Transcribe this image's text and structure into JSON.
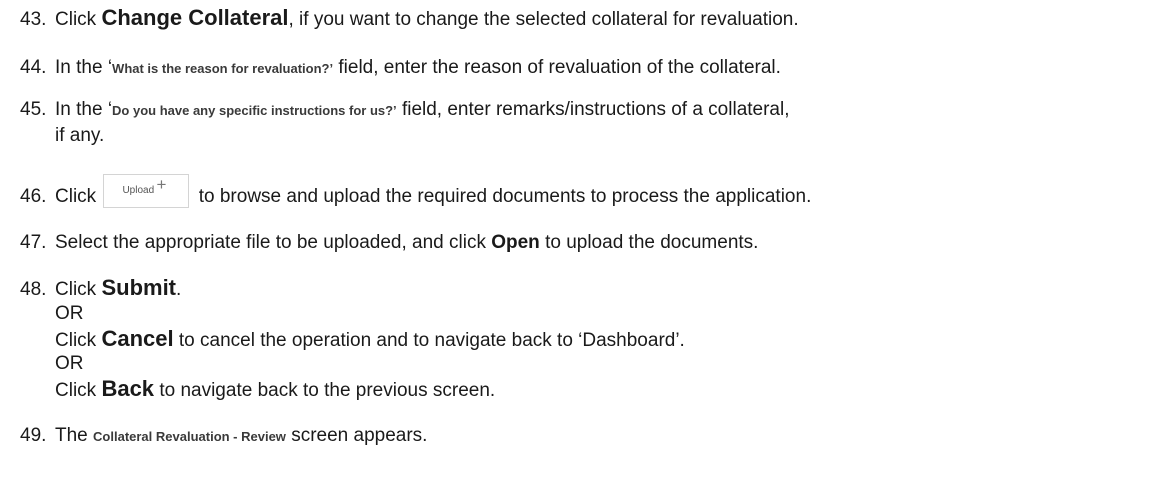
{
  "steps": {
    "s43": {
      "num": "43.",
      "pre": "Click ",
      "bold": "Change Collateral",
      "post": ", if you want to change the selected collateral for revaluation."
    },
    "s44": {
      "num": "44.",
      "pre": "In the ‘",
      "field": "What is the reason for revaluation?’",
      "post": " field, enter the reason of revaluation of the collateral."
    },
    "s45": {
      "num": "45.",
      "pre": "In the ‘",
      "field": "Do you have any specific instructions for us?’",
      "post": " field, enter remarks/instructions of a collateral,",
      "line2": "if any."
    },
    "s46": {
      "num": "46.",
      "pre": "Click",
      "upload_label": "Upload",
      "upload_plus": "+",
      "upload_icon": "plus-icon",
      "post": "to browse and upload the required documents to process the application."
    },
    "s47": {
      "num": "47.",
      "pre": "Select the appropriate file to be uploaded, and click ",
      "bold": "Open",
      "post": " to upload the documents."
    },
    "s48": {
      "num": "48.",
      "pre": "Click ",
      "submit": "Submit",
      "submit_post": ".",
      "or1": "OR",
      "cancel_pre": "Click ",
      "cancel": "Cancel",
      "cancel_post": " to cancel the operation and to navigate back to ‘Dashboard’.",
      "or2": "OR",
      "back_pre": "Click ",
      "back": "Back",
      "back_post": " to navigate back to the previous screen."
    },
    "s49": {
      "num": "49.",
      "pre": "The ",
      "screen": "Collateral Revaluation - Review",
      "post": " screen appears."
    }
  }
}
